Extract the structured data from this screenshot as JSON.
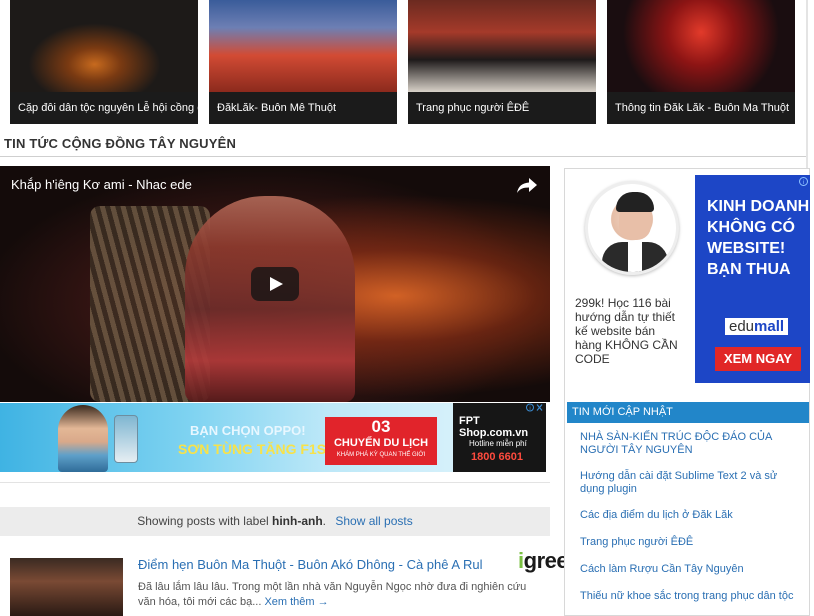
{
  "thumbnails": [
    {
      "caption": "Cặp đôi dân tộc nguyên Lễ hội cồng chiêng"
    },
    {
      "caption": "ĐăkLăk- Buôn Mê Thuột"
    },
    {
      "caption": "Trang phục người ÊĐÊ"
    },
    {
      "caption": "Thông tin Đăk Lăk - Buôn Ma Thuột"
    }
  ],
  "section_title": "TIN TỨC CỘNG ĐỒNG TÂY NGUYÊN",
  "video": {
    "title": "Khắp h'iêng Kơ ami - Nhac ede"
  },
  "banner": {
    "line1": "BẠN CHỌN OPPO!",
    "line2": "SƠN TÙNG TẶNG F1S",
    "number": "03",
    "box_line1": "CHUYẾN DU LỊCH",
    "box_line2": "KHÁM PHÁ KỲ QUAN THẾ GIỚI",
    "brand": "FPT Shop.com.vn",
    "hotline_label": "Hotline miễn phí",
    "hotline": "1800 6601"
  },
  "label_bar": {
    "prefix": "Showing posts with label",
    "label": "hinh-anh",
    "suffix": ".",
    "show_all": "Show all posts"
  },
  "post": {
    "title": "Điểm hẹn Buôn Ma Thuột - Buôn Akó Dhông - Cà phê A Rul",
    "snippet": "Đã lâu lắm lâu lâu. Trong một lần nhà văn Nguyễn Ngọc nhờ đưa đi nghiên cứu văn hóa, tôi mới các bạ...",
    "more": "Xem thêm →"
  },
  "watermark": {
    "part1": "i",
    "part2": "greensoft"
  },
  "sidebar": {
    "ad": {
      "text": "299k! Học 116 bài hướng dẫn tự thiết kế website bán hàng KHÔNG CẦN CODE",
      "headline": "KINH DOANH KHÔNG CÓ WEBSITE! BẠN THUA",
      "brand_a": "edu",
      "brand_b": "mall",
      "cta": "XEM NGAY"
    },
    "heading": "TIN MỚI CẬP NHẬT",
    "items": [
      "NHÀ SÀN-KIẾN TRÚC ĐỘC ĐÁO CỦA NGƯỜI TÂY NGUYÊN",
      "Hướng dẫn cài đặt Sublime Text 2 và sử dụng plugin",
      "Các địa điểm du lịch ở Đăk Lăk",
      "Trang phục người ÊĐÊ",
      "Cách làm Rượu Cần Tây Nguyên",
      "Thiếu nữ khoe sắc trong trang phục dân tộc"
    ]
  }
}
